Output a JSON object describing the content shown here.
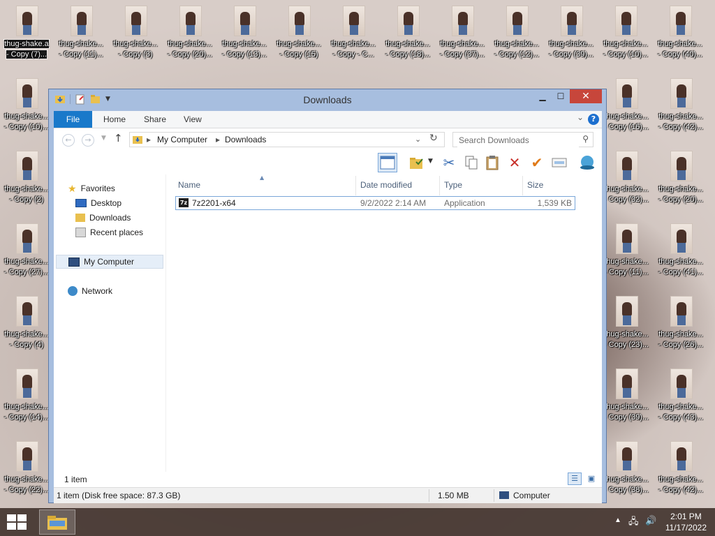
{
  "desktop": {
    "icons_row1": [
      {
        "label": "thug-shake.a - Copy (7)...",
        "selected": true
      },
      {
        "label": "thug-shake... - Copy (11)..."
      },
      {
        "label": "thug-shake... - Copy (3)"
      },
      {
        "label": "thug-shake... - Copy (20)..."
      },
      {
        "label": "thug-shake... - Copy (13)..."
      },
      {
        "label": "thug-shake... - Copy (15)"
      },
      {
        "label": "thug-shake... - Copy - C..."
      },
      {
        "label": "thug-shake... - Copy (18)..."
      },
      {
        "label": "thug-shake... - Copy (37)..."
      },
      {
        "label": "thug-shake... - Copy (12)..."
      },
      {
        "label": "thug-shake... - Copy (39)..."
      },
      {
        "label": "thug-shake... - Copy (10)..."
      },
      {
        "label": "thug-shake... - Copy (40)..."
      }
    ],
    "left_col": [
      "thug-shake... - Copy (10)...",
      "thug-shake... - Copy (2)",
      "thug-shake... - Copy (27)...",
      "thug-shake... - Copy (4)",
      "thug-shake... - Copy (14)...",
      "thug-shake... - Copy (22)..."
    ],
    "right_col1": [
      "thug-shake... - Copy (16)...",
      "thug-shake... - Copy (32)...",
      "thug-shake... - Copy (11)...",
      "thug-shake... - Copy (23)...",
      "thug-shake... - Copy (39)...",
      "thug-shake... - Copy (38)..."
    ],
    "right_col2": [
      "thug-shake... - Copy (42)...",
      "thug-shake... - Copy (20)...",
      "thug-shake... - Copy (41)...",
      "thug-shake... - Copy (26)...",
      "thug-shake... - Copy (43)...",
      "thug-shake... - Copy (42)..."
    ]
  },
  "window": {
    "title": "Downloads",
    "ribbon_tabs": [
      "File",
      "Home",
      "Share",
      "View"
    ],
    "address": [
      "My Computer",
      "Downloads"
    ],
    "search_placeholder": "Search Downloads",
    "nav": {
      "favorites": "Favorites",
      "desktop": "Desktop",
      "downloads": "Downloads",
      "recent": "Recent places",
      "computer": "My Computer",
      "network": "Network"
    },
    "columns": {
      "name": "Name",
      "date": "Date modified",
      "type": "Type",
      "size": "Size"
    },
    "files": [
      {
        "name": "7z2201-x64",
        "date": "9/2/2022 2:14 AM",
        "type": "Application",
        "size": "1,539 KB"
      }
    ],
    "status_items": "1 item",
    "bottom": {
      "details": "1 item (Disk free space: 87.3 GB)",
      "size": "1.50 MB",
      "location": "Computer"
    }
  },
  "taskbar": {
    "time": "2:01 PM",
    "date": "11/17/2022"
  }
}
